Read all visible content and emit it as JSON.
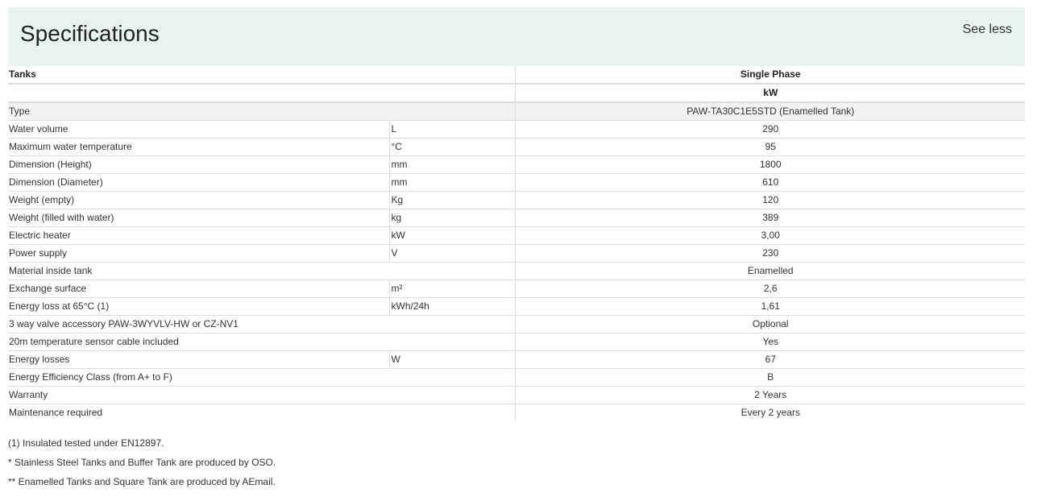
{
  "header": {
    "title": "Specifications",
    "toggle_label": "See less"
  },
  "table": {
    "head": {
      "label": "Tanks",
      "value": "Single Phase"
    },
    "subhead": {
      "value": "kW"
    },
    "rows": [
      {
        "label": "Type",
        "unit": "",
        "value": "PAW-TA30C1E5STD (Enamelled Tank)"
      },
      {
        "label": "Water volume",
        "unit": "L",
        "value": "290"
      },
      {
        "label": "Maximum water temperature",
        "unit": "°C",
        "value": "95"
      },
      {
        "label": "Dimension (Height)",
        "unit": "mm",
        "value": "1800"
      },
      {
        "label": "Dimension (Diameter)",
        "unit": "mm",
        "value": "610"
      },
      {
        "label": "Weight (empty)",
        "unit": "Kg",
        "value": "120"
      },
      {
        "label": "Weight (filled with water)",
        "unit": "kg",
        "value": "389"
      },
      {
        "label": "Electric heater",
        "unit": "kW",
        "value": "3,00"
      },
      {
        "label": "Power supply",
        "unit": "V",
        "value": "230"
      },
      {
        "label": "Material inside tank",
        "unit": "",
        "value": "Enamelled"
      },
      {
        "label": "Exchange surface",
        "unit": "m²",
        "value": "2,6"
      },
      {
        "label": "Energy loss at 65°C (1)",
        "unit": "kWh/24h",
        "value": "1,61"
      },
      {
        "label": "3 way valve accessory PAW-3WYVLV-HW or CZ-NV1",
        "unit": "",
        "value": "Optional"
      },
      {
        "label": "20m temperature sensor cable included",
        "unit": "",
        "value": "Yes"
      },
      {
        "label": "Energy losses",
        "unit": "W",
        "value": "67"
      },
      {
        "label": "Energy Efficiency Class (from A+ to F)",
        "unit": "",
        "value": "B"
      },
      {
        "label": "Warranty",
        "unit": "",
        "value": "2 Years"
      },
      {
        "label": "Maintenance required",
        "unit": "",
        "value": "Every 2 years"
      }
    ]
  },
  "notes": [
    "(1) Insulated tested under EN12897.",
    "* Stainless Steel Tanks and Buffer Tank are produced by OSO.",
    "** Enamelled Tanks and Square Tank are produced by AEmail."
  ]
}
